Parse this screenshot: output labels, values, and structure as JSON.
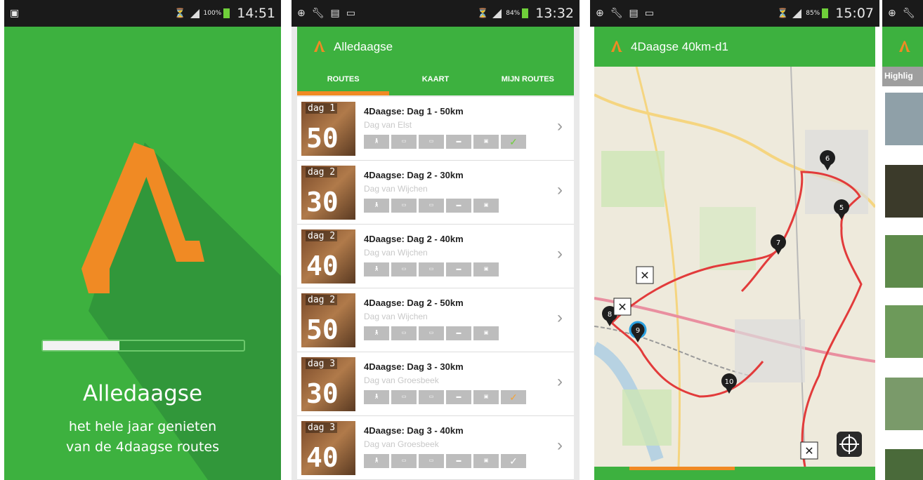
{
  "splash": {
    "status_time": "14:51",
    "status_pct": "100%",
    "title": "Alledaagse",
    "subtitle_line1": "het hele jaar genieten",
    "subtitle_line2": "van de 4daagse routes",
    "progress_fraction": 0.38
  },
  "routes_screen": {
    "status_time": "13:32",
    "status_pct": "84%",
    "app_title": "Alledaagse",
    "tabs": [
      {
        "label": "ROUTES",
        "active": true
      },
      {
        "label": "KAART",
        "active": false
      },
      {
        "label": "MIJN ROUTES",
        "active": false
      }
    ],
    "routes": [
      {
        "thumb_day": "dag 1",
        "thumb_km": "50",
        "title": "4Daagse: Dag 1 - 50km",
        "subtitle": "Dag van Elst",
        "checked": "green"
      },
      {
        "thumb_day": "dag 2",
        "thumb_km": "30",
        "title": "4Daagse: Dag 2 - 30km",
        "subtitle": "Dag van Wijchen",
        "checked": "none"
      },
      {
        "thumb_day": "dag 2",
        "thumb_km": "40",
        "title": "4Daagse: Dag 2 - 40km",
        "subtitle": "Dag van Wijchen",
        "checked": "none"
      },
      {
        "thumb_day": "dag 2",
        "thumb_km": "50",
        "title": "4Daagse: Dag 2 - 50km",
        "subtitle": "Dag van Wijchen",
        "checked": "none"
      },
      {
        "thumb_day": "dag 3",
        "thumb_km": "30",
        "title": "4Daagse: Dag 3 - 30km",
        "subtitle": "Dag van Groesbeek",
        "checked": "orange"
      },
      {
        "thumb_day": "dag 3",
        "thumb_km": "40",
        "title": "4Daagse: Dag 3 - 40km",
        "subtitle": "Dag van Groesbeek",
        "checked": "white"
      }
    ]
  },
  "map_screen": {
    "status_time": "15:07",
    "status_pct": "85%",
    "app_title": "4Daagse 40km-d1",
    "markers": [
      "5",
      "6",
      "7",
      "8",
      "9",
      "10"
    ]
  },
  "highlights_screen": {
    "header": "Highlig"
  },
  "colors": {
    "brand_green": "#3db13f",
    "accent_orange": "#f08a24",
    "route_red": "#e23b3b"
  }
}
